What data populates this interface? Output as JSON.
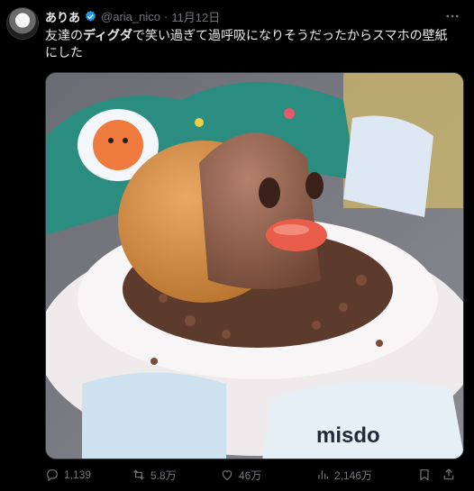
{
  "post": {
    "display_name": "ありあ",
    "handle": "@aria_nico",
    "separator": "·",
    "date": "11月12日",
    "text_before": "友達の",
    "text_emphasis": "ディグダ",
    "text_after": "で笑い過ぎて過呼吸になりそうだったからスマホの壁紙にした",
    "image_caption_text": "misdo"
  },
  "actions": {
    "replies": "1,139",
    "reposts": "5.8万",
    "likes": "46万",
    "views": "2,146万"
  },
  "colors": {
    "background": "#000000",
    "text": "#e7e9ea",
    "muted": "#71767b",
    "verified": "#1d9bf0"
  },
  "icons": {
    "verified": "verified-badge-icon",
    "more": "more-icon",
    "reply": "reply-icon",
    "repost": "repost-icon",
    "like": "like-icon",
    "views": "views-icon",
    "bookmark": "bookmark-icon",
    "share": "share-icon"
  }
}
